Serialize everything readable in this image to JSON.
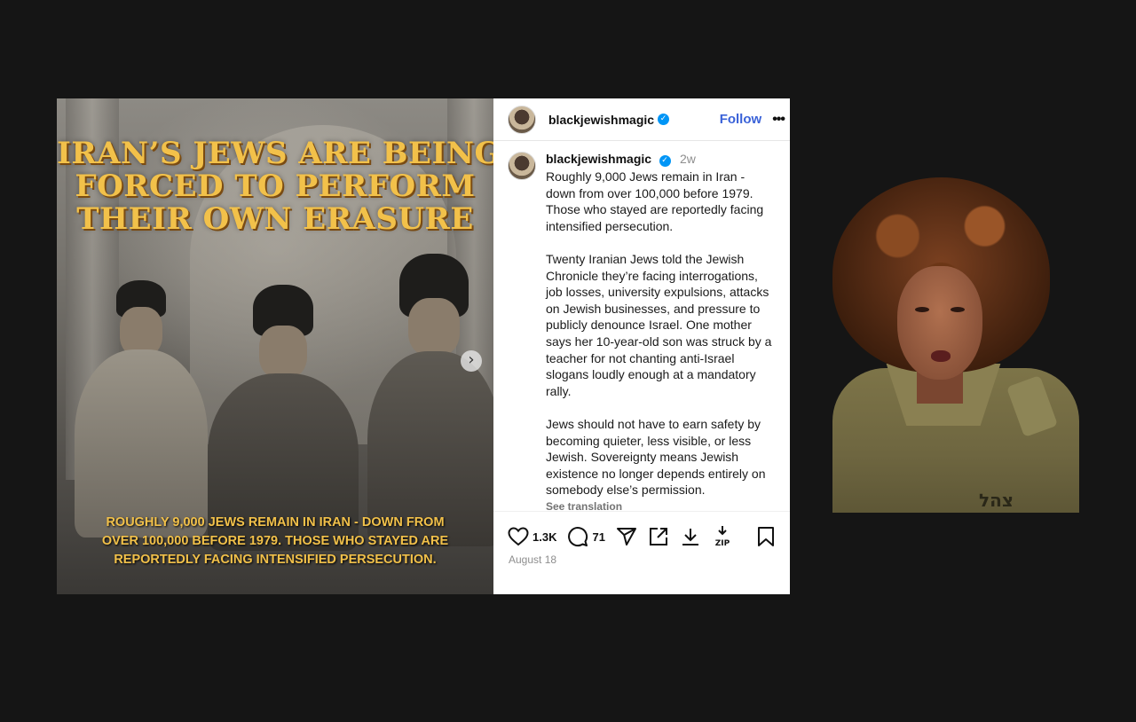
{
  "post_image": {
    "headline_lines": [
      "IRAN’S JEWS ARE BEING",
      "FORCED TO PERFORM",
      "THEIR OWN ERASURE"
    ],
    "caption_lines": [
      "ROUGHLY 9,000 JEWS REMAIN IN IRAN - DOWN FROM",
      "OVER 100,000 BEFORE 1979. THOSE WHO STAYED ARE",
      "REPORTEDLY FACING INTENSIFIED PERSECUTION."
    ],
    "next_icon": "chevron-right-icon"
  },
  "header": {
    "username": "blackjewishmagic",
    "follow_label": "Follow",
    "more_label": "•••"
  },
  "caption": {
    "username": "blackjewishmagic",
    "time": "2w",
    "text": "Roughly 9,000 Jews remain in Iran - down from over 100,000 before 1979. Those who stayed are reportedly facing intensified persecution.\n\nTwenty Iranian Jews told the Jewish Chronicle they’re facing interrogations, job losses, university expulsions, attacks on Jewish businesses, and pressure to publicly denounce Israel. One mother says her 10-year-old son was struck by a teacher for not chanting anti-Israel slogans loudly enough at a mandatory rally.\n\nJews should not have to earn safety by becoming quieter, less visible, or less Jewish. Sovereignty means Jewish existence no longer depends entirely on somebody else’s permission.",
    "see_translation": "See translation"
  },
  "actions": {
    "likes": "1.3K",
    "comments": "71",
    "icons": [
      "heart-icon",
      "comment-icon",
      "share-icon",
      "external-link-icon",
      "download-icon",
      "zip-icon",
      "bookmark-icon"
    ],
    "zip_label": "ZIP"
  },
  "date": "August 18",
  "person": {
    "patch_text": "צהל"
  },
  "colors": {
    "background": "#151515",
    "headline": "#f2c14a",
    "follow": "#3a62d8",
    "verified": "#0095f6"
  }
}
